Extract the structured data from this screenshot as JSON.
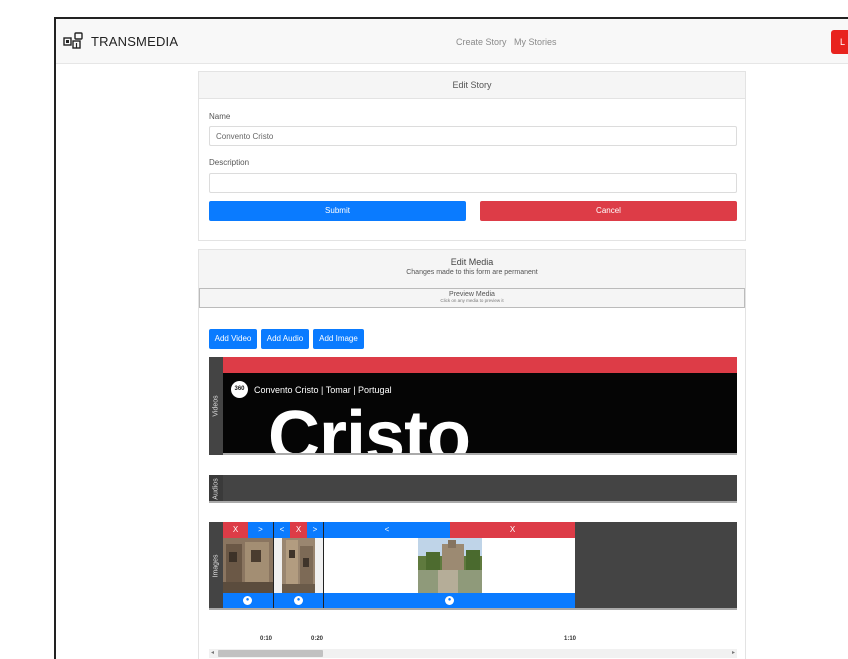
{
  "navbar": {
    "brand": "TRANSMEDIA",
    "links": [
      "Create Story",
      "My Stories"
    ],
    "right_button": "L"
  },
  "edit_story": {
    "header": "Edit Story",
    "name_label": "Name",
    "name_value": "Convento Cristo",
    "description_label": "Description",
    "description_value": "",
    "submit": "Submit",
    "cancel": "Cancel"
  },
  "edit_media": {
    "header": "Edit Media",
    "subheader": "Changes made to this form are permanent",
    "preview_title": "Preview Media",
    "preview_hint": "Click on any media to preview it",
    "buttons": [
      "Add Video",
      "Add Audio",
      "Add Image"
    ],
    "tracks": {
      "videos": "Videos",
      "audios": "Audios",
      "images": "Images"
    },
    "video_clip": {
      "badge": "360",
      "title": "Convento Cristo | Tomar | Portugal",
      "big_text": "Cristo"
    },
    "image_controls": {
      "x": "X",
      "next": ">",
      "prev": "<",
      "clock": "🕐"
    },
    "ticks": [
      "0:10",
      "0:20",
      "1:10"
    ],
    "scroll_left": "◂",
    "scroll_right": "▸"
  },
  "colors": {
    "blue": "#0a7bff",
    "red": "#dd3c47",
    "track_dark": "#444444",
    "nav_red": "#e8231e"
  }
}
